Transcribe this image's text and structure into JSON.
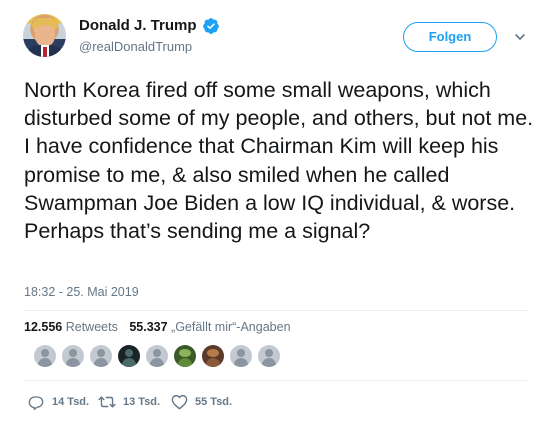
{
  "header": {
    "name": "Donald J. Trump",
    "handle": "@realDonaldTrump",
    "verified_icon": "verified-badge-icon",
    "follow_label": "Folgen",
    "menu_icon": "chevron-down-icon"
  },
  "tweet": {
    "text": "North Korea fired off some small weapons, which disturbed some of my people, and others, but not me. I have confidence that Chairman Kim will keep his promise to me, & also smiled when he called Swampman Joe Biden a low IQ individual, & worse. Perhaps that’s sending me a signal?",
    "timestamp": "18:32 - 25. Mai 2019"
  },
  "stats": {
    "retweets_count": "12.556",
    "retweets_label": "Retweets",
    "likes_count": "55.337",
    "likes_label": "„Gefällt mir“-Angaben"
  },
  "likers": [
    "default",
    "default",
    "default",
    "dark",
    "default",
    "frog",
    "dog",
    "default",
    "default"
  ],
  "actions": {
    "reply_count": "14 Tsd.",
    "retweet_count": "13 Tsd.",
    "like_count": "55 Tsd."
  },
  "colors": {
    "accent": "#1da1f2",
    "text": "#14171a",
    "muted": "#657786",
    "divider": "#e6ecf0"
  }
}
